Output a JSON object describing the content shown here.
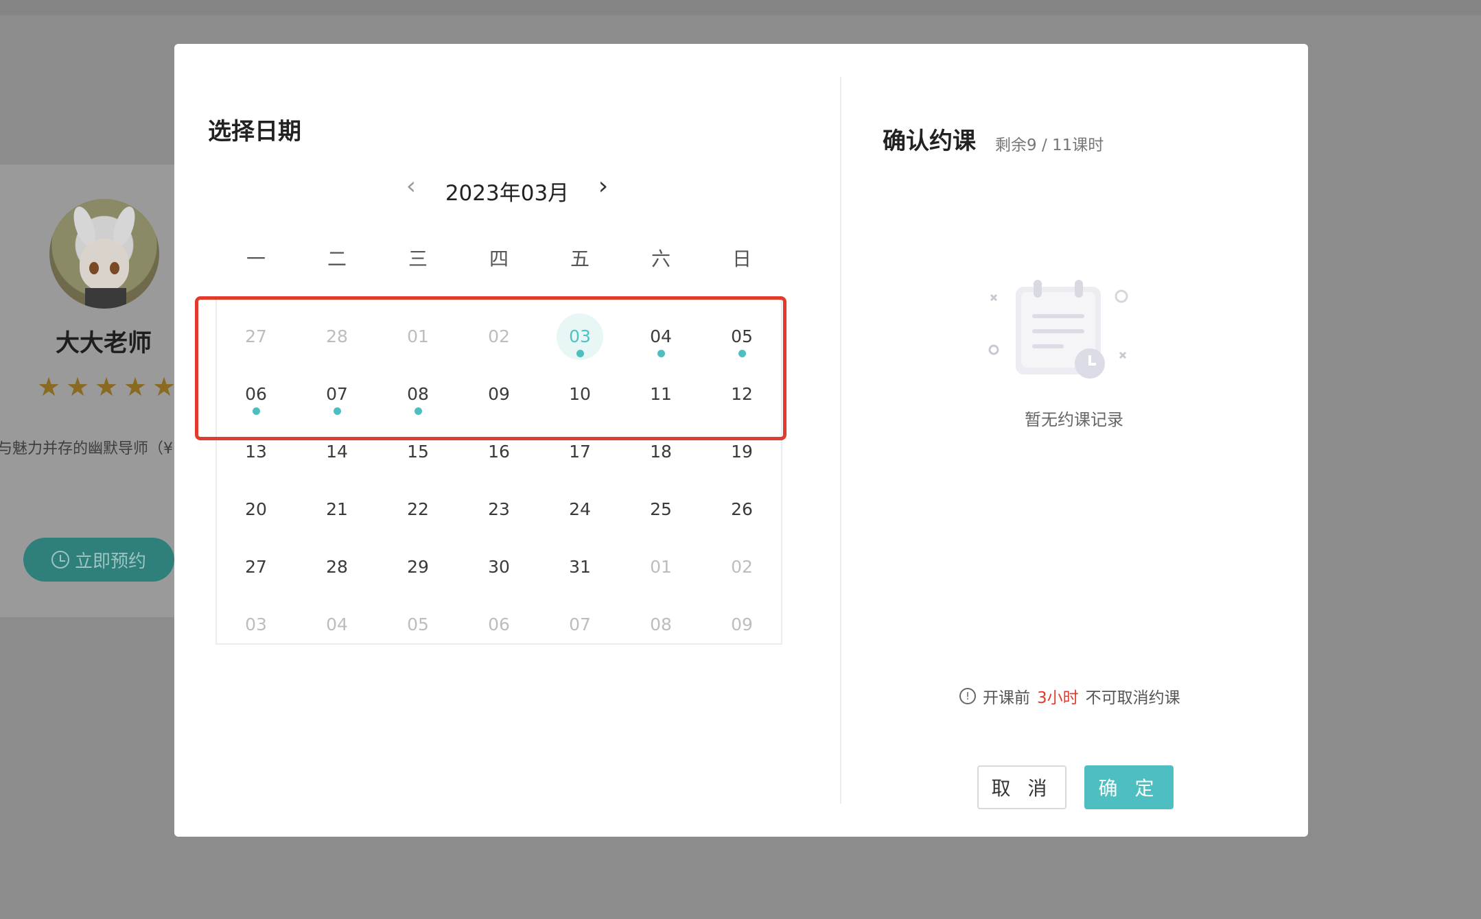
{
  "background": {
    "teacher_name": "大大老师",
    "rating_stars": 5,
    "description": "与魅力并存的幽默导师（¥",
    "book_button": "立即预约"
  },
  "calendar": {
    "title": "选择日期",
    "month": "2023年03月",
    "prev_label": "‹",
    "next_label": "›",
    "weekdays": [
      "一",
      "二",
      "三",
      "四",
      "五",
      "六",
      "日"
    ],
    "days": [
      {
        "label": "27",
        "muted": true
      },
      {
        "label": "28",
        "muted": true
      },
      {
        "label": "01",
        "muted": true
      },
      {
        "label": "02",
        "muted": true
      },
      {
        "label": "03",
        "today": true,
        "dot": true
      },
      {
        "label": "04",
        "dot": true
      },
      {
        "label": "05",
        "dot": true
      },
      {
        "label": "06",
        "dot": true
      },
      {
        "label": "07",
        "dot": true
      },
      {
        "label": "08",
        "dot": true
      },
      {
        "label": "09"
      },
      {
        "label": "10"
      },
      {
        "label": "11"
      },
      {
        "label": "12"
      },
      {
        "label": "13"
      },
      {
        "label": "14"
      },
      {
        "label": "15"
      },
      {
        "label": "16"
      },
      {
        "label": "17"
      },
      {
        "label": "18"
      },
      {
        "label": "19"
      },
      {
        "label": "20"
      },
      {
        "label": "21"
      },
      {
        "label": "22"
      },
      {
        "label": "23"
      },
      {
        "label": "24"
      },
      {
        "label": "25"
      },
      {
        "label": "26"
      },
      {
        "label": "27"
      },
      {
        "label": "28"
      },
      {
        "label": "29"
      },
      {
        "label": "30"
      },
      {
        "label": "31"
      },
      {
        "label": "01",
        "muted": true
      },
      {
        "label": "02",
        "muted": true
      },
      {
        "label": "03",
        "muted": true
      },
      {
        "label": "04",
        "muted": true
      },
      {
        "label": "05",
        "muted": true
      },
      {
        "label": "06",
        "muted": true
      },
      {
        "label": "07",
        "muted": true
      },
      {
        "label": "08",
        "muted": true
      },
      {
        "label": "09",
        "muted": true
      }
    ]
  },
  "confirm": {
    "title": "确认约课",
    "remaining": "剩余9 / 11课时",
    "empty_text": "暂无约课记录",
    "notice_prefix": "开课前",
    "notice_highlight": "3小时",
    "notice_suffix": "不可取消约课",
    "cancel_label": "取 消",
    "ok_label": "确 定"
  },
  "colors": {
    "accent": "#4dbfc0",
    "highlight_border": "#e33a2d",
    "warning": "#e33a2d"
  }
}
